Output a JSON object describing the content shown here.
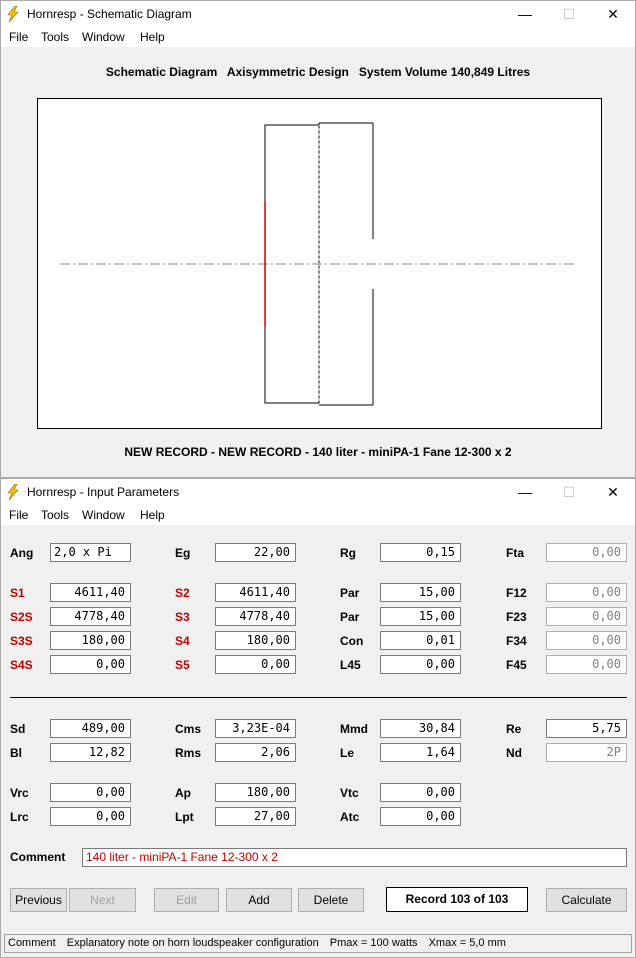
{
  "schematic_window": {
    "title": "Hornresp - Schematic Diagram",
    "menu": [
      "File",
      "Tools",
      "Window",
      "Help"
    ],
    "header": "Schematic Diagram   Axisymmetric Design   System Volume 140,849 Litres",
    "footer": "NEW RECORD - NEW RECORD - 140 liter - miniPA-1 Fane 12-300 x 2",
    "controls": {
      "minimize": "—",
      "maximize": "☐",
      "close": "✕"
    }
  },
  "input_window": {
    "title": "Hornresp - Input Parameters",
    "menu": [
      "File",
      "Tools",
      "Window",
      "Help"
    ],
    "controls": {
      "minimize": "—",
      "maximize": "☐",
      "close": "✕"
    },
    "col1": [
      {
        "label": "Ang",
        "value": "2,0 x Pi"
      },
      {
        "label": "S1",
        "value": "4611,40"
      },
      {
        "label": "S2S",
        "value": "4778,40"
      },
      {
        "label": "S3S",
        "value": "180,00"
      },
      {
        "label": "S4S",
        "value": "0,00"
      }
    ],
    "col2": [
      {
        "label": "Eg",
        "value": "22,00"
      },
      {
        "label": "S2",
        "value": "4611,40"
      },
      {
        "label": "S3",
        "value": "4778,40"
      },
      {
        "label": "S4",
        "value": "180,00"
      },
      {
        "label": "S5",
        "value": "0,00"
      }
    ],
    "col3": [
      {
        "label": "Rg",
        "value": "0,15"
      },
      {
        "label": "Par",
        "value": "15,00"
      },
      {
        "label": "Par",
        "value": "15,00"
      },
      {
        "label": "Con",
        "value": "0,01"
      },
      {
        "label": "L45",
        "value": "0,00"
      }
    ],
    "col4": [
      {
        "label": "Fta",
        "value": "0,00"
      },
      {
        "label": "F12",
        "value": "0,00"
      },
      {
        "label": "F23",
        "value": "0,00"
      },
      {
        "label": "F34",
        "value": "0,00"
      },
      {
        "label": "F45",
        "value": "0,00"
      }
    ],
    "driver": [
      {
        "label": "Sd",
        "value": "489,00"
      },
      {
        "label": "Cms",
        "value": "3,23E-04"
      },
      {
        "label": "Mmd",
        "value": "30,84"
      },
      {
        "label": "Re",
        "value": "5,75"
      },
      {
        "label": "Bl",
        "value": "12,82"
      },
      {
        "label": "Rms",
        "value": "2,06"
      },
      {
        "label": "Le",
        "value": "1,64"
      },
      {
        "label": "Nd",
        "value": "2P"
      },
      {
        "label": "Vrc",
        "value": "0,00"
      },
      {
        "label": "Ap",
        "value": "180,00"
      },
      {
        "label": "Vtc",
        "value": "0,00"
      },
      {
        "label": "Lrc",
        "value": "0,00"
      },
      {
        "label": "Lpt",
        "value": "27,00"
      },
      {
        "label": "Atc",
        "value": "0,00"
      }
    ],
    "comment_label": "Comment",
    "comment_value": "140 liter - miniPA-1 Fane 12-300 x 2",
    "buttons": {
      "previous": "Previous",
      "next": "Next",
      "edit": "Edit",
      "add": "Add",
      "delete": "Delete",
      "calculate": "Calculate"
    },
    "record": "Record 103 of 103",
    "status": {
      "field": "Comment",
      "description": "Explanatory note on horn loudspeaker configuration",
      "pmax": "Pmax = 100 watts",
      "xmax": "Xmax = 5,0 mm"
    },
    "colors": {
      "red_label": "#c00000",
      "accent_icon": "#f5c400"
    }
  }
}
